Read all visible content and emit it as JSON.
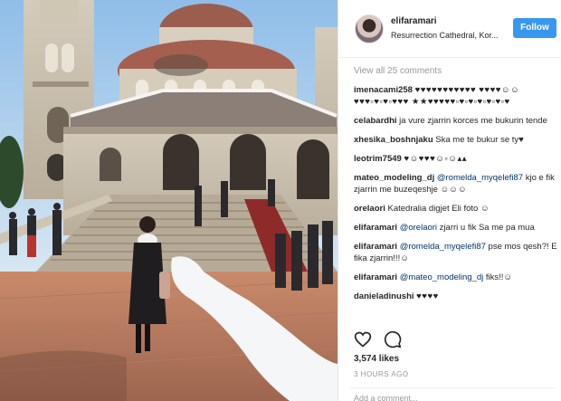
{
  "post": {
    "username": "elifaramari",
    "location": "Resurrection Cathedral, Kor...",
    "follow_label": "Follow",
    "view_all_comments": "View all 25 comments",
    "likes": "3,574 likes",
    "time": "3 HOURS AGO",
    "add_comment_placeholder": "Add a comment..."
  },
  "comments": [
    {
      "user": "imenacami258",
      "text": "♥♥♥♥♥♥♥♥♥♥♥ ♥♥♥♥☺☺♥♥♥▫♥▫♥▫♥♥♥ ★★♥♥♥♥♥▫♥▫♥▫♥▫♥▫♥▫♥"
    },
    {
      "user": "celabardhi",
      "text": "ja vure zjarrin korces me bukurin tende"
    },
    {
      "user": "xhesika_boshnjaku",
      "text": "Ska me te bukur se ty♥"
    },
    {
      "user": "leotrim7549",
      "text": "♥☺♥♥♥☺▫☺▴▴"
    },
    {
      "user": "mateo_modeling_dj",
      "mention": "@romelda_myqelefi87",
      "text": "kjo e fik zjarrin me buzeqeshje ☺☺☺"
    },
    {
      "user": "orelaori",
      "text": "Katedralia digjet Eli foto ☺"
    },
    {
      "user": "elifaramari",
      "mention": "@orelaori",
      "text": "zjarri u fik Sa me pa mua"
    },
    {
      "user": "elifaramari",
      "mention": "@romelda_myqelefi87",
      "text": "pse mos qesh?! E fika zjarrin!!!☺"
    },
    {
      "user": "elifaramari",
      "mention": "@mateo_modeling_dj",
      "text": "fiks!!☺"
    },
    {
      "user": "danieladinushi",
      "text": "♥♥♥♥"
    }
  ],
  "icons": {
    "like": "heart-icon",
    "comment": "comment-bubble-icon"
  },
  "colors": {
    "follow_button": "#3897f0",
    "mention": "#003569"
  }
}
